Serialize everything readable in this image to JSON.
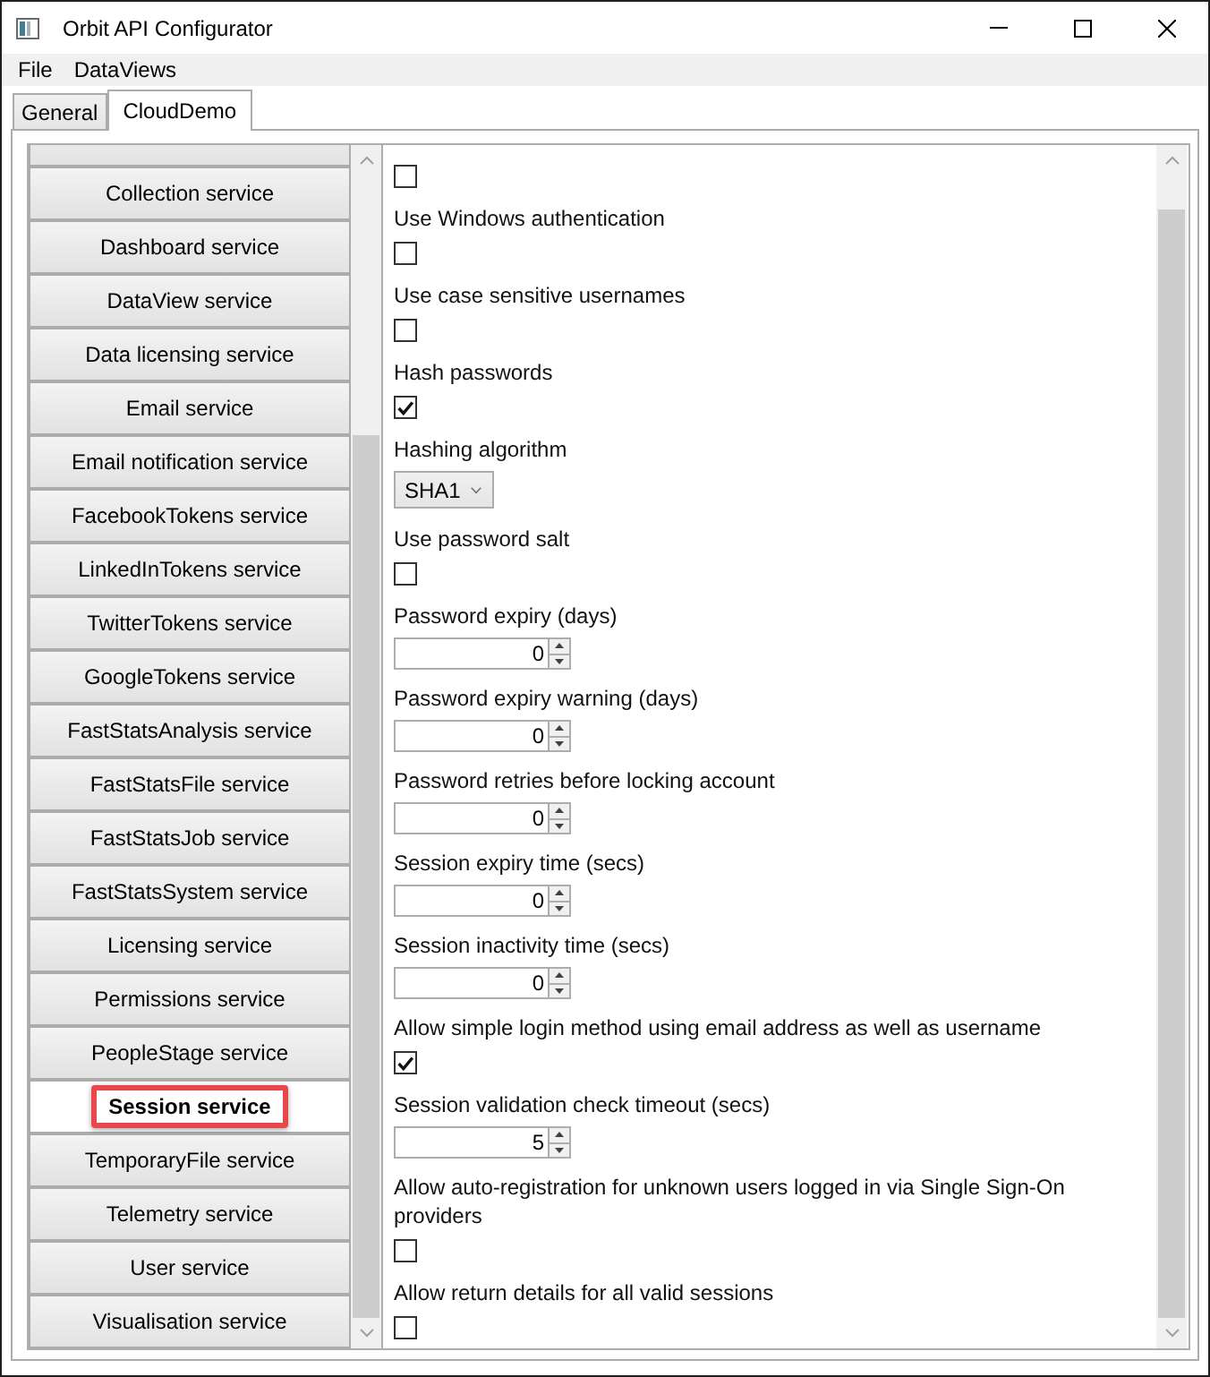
{
  "window": {
    "title": "Orbit API Configurator"
  },
  "menu": [
    "File",
    "DataViews"
  ],
  "tabs": [
    {
      "label": "General",
      "selected": false
    },
    {
      "label": "CloudDemo",
      "selected": true
    }
  ],
  "services": [
    {
      "selected": false,
      "highlighted": false
    },
    {
      "label": "Collection service",
      "selected": false,
      "highlighted": false
    },
    {
      "label": "Dashboard service",
      "selected": false,
      "highlighted": false
    },
    {
      "label": "DataView service",
      "selected": false,
      "highlighted": false
    },
    {
      "label": "Data licensing service",
      "selected": false,
      "highlighted": false
    },
    {
      "label": "Email service",
      "selected": false,
      "highlighted": false
    },
    {
      "label": "Email notification service",
      "selected": false,
      "highlighted": false
    },
    {
      "label": "FacebookTokens service",
      "selected": false,
      "highlighted": false
    },
    {
      "label": "LinkedInTokens service",
      "selected": false,
      "highlighted": false
    },
    {
      "label": "TwitterTokens service",
      "selected": false,
      "highlighted": false
    },
    {
      "label": "GoogleTokens service",
      "selected": false,
      "highlighted": false
    },
    {
      "label": "FastStatsAnalysis service",
      "selected": false,
      "highlighted": false
    },
    {
      "label": "FastStatsFile service",
      "selected": false,
      "highlighted": false
    },
    {
      "label": "FastStatsJob service",
      "selected": false,
      "highlighted": false
    },
    {
      "label": "FastStatsSystem service",
      "selected": false,
      "highlighted": false
    },
    {
      "label": "Licensing service",
      "selected": false,
      "highlighted": false
    },
    {
      "label": "Permissions service",
      "selected": false,
      "highlighted": false
    },
    {
      "label": "PeopleStage service",
      "selected": false,
      "highlighted": false
    },
    {
      "label": "Session service",
      "selected": true,
      "highlighted": true
    },
    {
      "label": "TemporaryFile service",
      "selected": false,
      "highlighted": false
    },
    {
      "label": "Telemetry service",
      "selected": false,
      "highlighted": false
    },
    {
      "label": "User service",
      "selected": false,
      "highlighted": false
    },
    {
      "label": "Visualisation service",
      "selected": false,
      "highlighted": false
    }
  ],
  "settings": [
    {
      "kind": "checkbox",
      "checked": false
    },
    {
      "kind": "checkbox",
      "label": "Use Windows authentication",
      "checked": false
    },
    {
      "kind": "checkbox",
      "label": "Use case sensitive usernames",
      "checked": false
    },
    {
      "kind": "checkbox",
      "label": "Hash passwords",
      "checked": true
    },
    {
      "kind": "dropdown",
      "label": "Hashing algorithm",
      "value": "SHA1"
    },
    {
      "kind": "checkbox",
      "label": "Use password salt",
      "checked": false
    },
    {
      "kind": "number",
      "label": "Password expiry (days)",
      "value": "0"
    },
    {
      "kind": "number",
      "label": "Password expiry warning (days)",
      "value": "0"
    },
    {
      "kind": "number",
      "label": "Password retries before locking account",
      "value": "0"
    },
    {
      "kind": "number",
      "label": "Session expiry time (secs)",
      "value": "0"
    },
    {
      "kind": "number",
      "label": "Session inactivity time (secs)",
      "value": "0"
    },
    {
      "kind": "checkbox",
      "label": "Allow simple login method using email address as well as username",
      "checked": true
    },
    {
      "kind": "number",
      "label": "Session validation check timeout (secs)",
      "value": "5"
    },
    {
      "kind": "checkbox",
      "label": "Allow auto-registration for unknown users logged in via Single Sign-On providers",
      "checked": false
    },
    {
      "kind": "checkbox",
      "label": "Allow return details for all valid sessions",
      "checked": false
    }
  ]
}
